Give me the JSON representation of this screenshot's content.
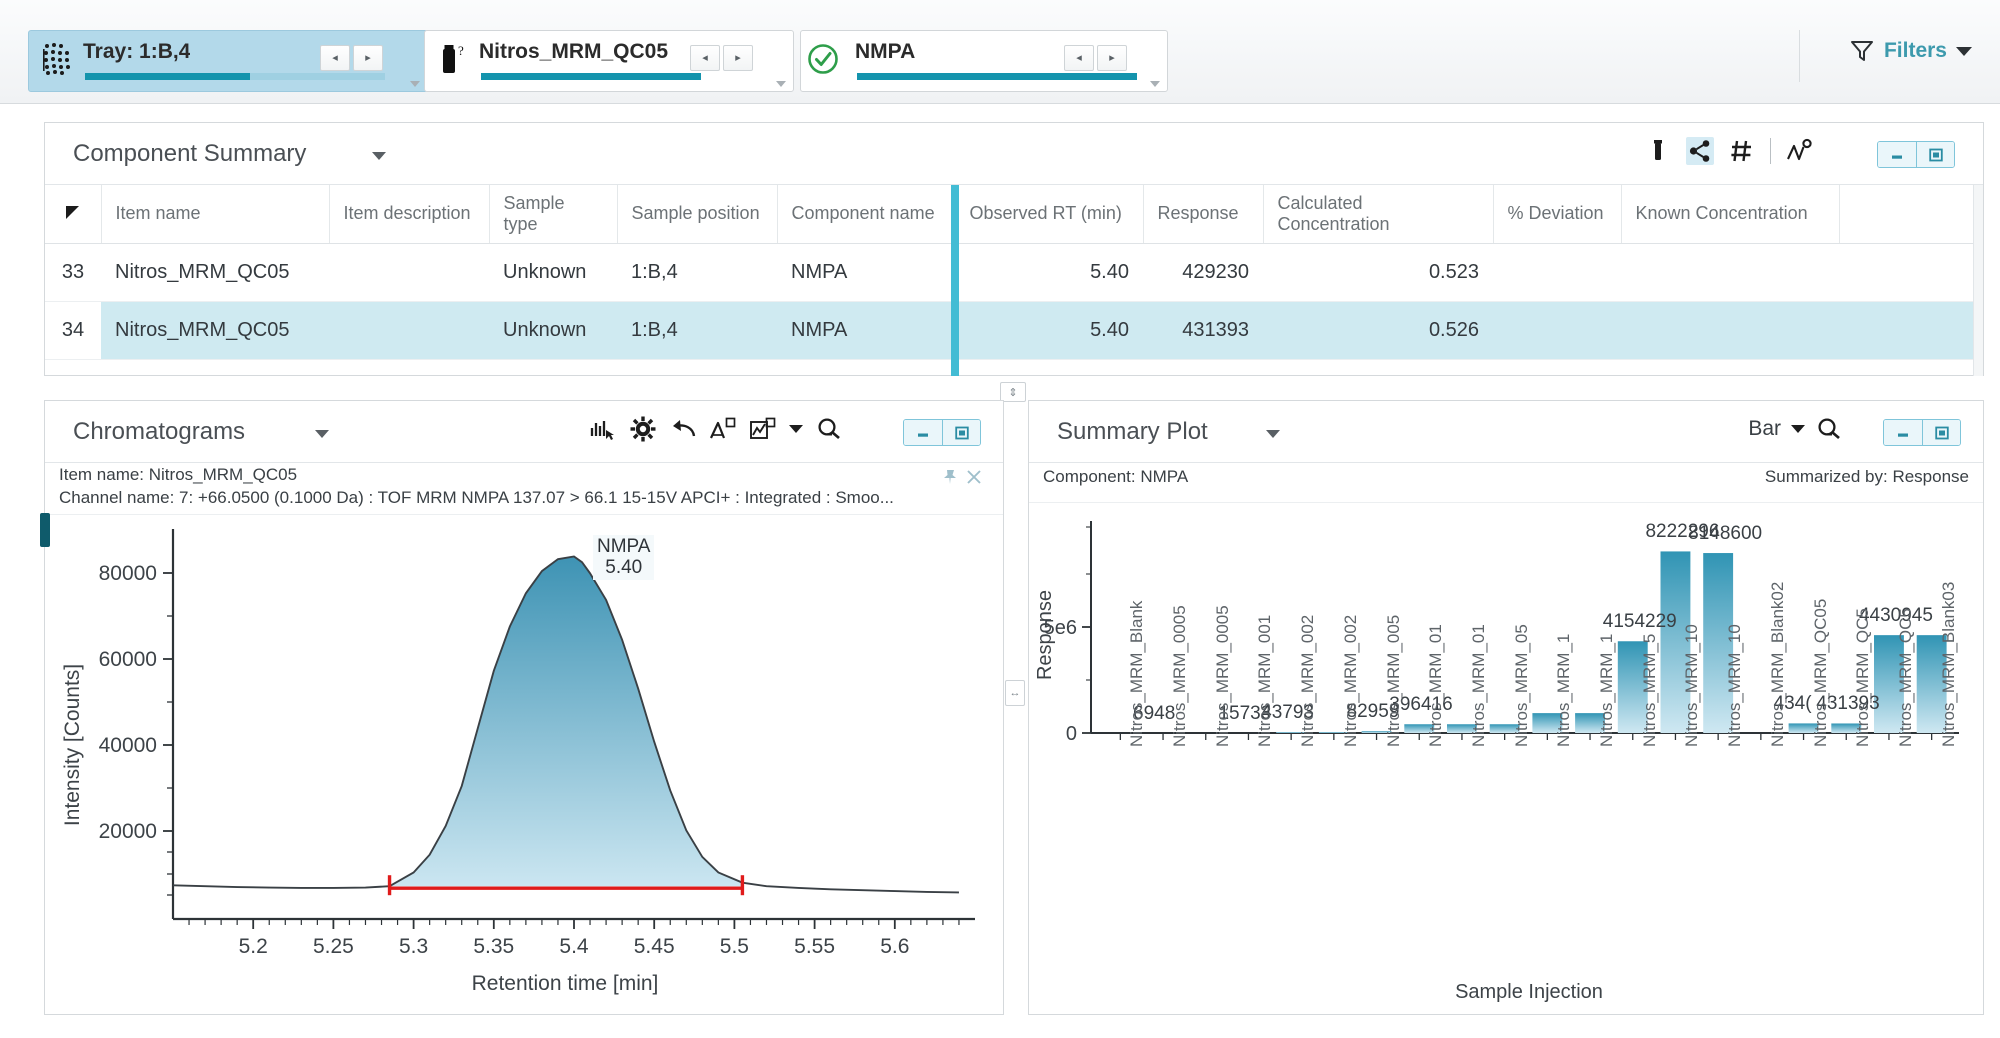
{
  "topbar": {
    "chips": [
      {
        "icon": "tray-grid-icon",
        "label": "Tray: 1:B,4",
        "progress": 55,
        "active": true
      },
      {
        "icon": "vial-question-icon",
        "label": "Nitros_MRM_QC05",
        "progress": 100,
        "active": false
      },
      {
        "icon": "check-circle-icon",
        "label": "NMPA",
        "progress": 100,
        "active": false
      }
    ],
    "prev_label": "◂",
    "next_label": "▸",
    "filters_label": "Filters"
  },
  "component_summary": {
    "title": "Component Summary",
    "tools": [
      "vial-icon",
      "share-icon",
      "hash-icon",
      "peak-settings-icon"
    ],
    "window_buttons": [
      "minimize-icon",
      "maximize-icon"
    ],
    "columns": [
      "Item name",
      "Item description",
      "Sample type",
      "Sample position",
      "Component name",
      "Observed RT (min)",
      "Response",
      "Calculated Concentration",
      "% Deviation",
      "Known Concentration",
      ""
    ],
    "rows": [
      {
        "index": "33",
        "item_name": "Nitros_MRM_QC05",
        "item_description": "",
        "sample_type": "Unknown",
        "sample_position": "1:B,4",
        "component_name": "NMPA",
        "observed_rt": "5.40",
        "response": "429230",
        "calculated_concentration": "0.523",
        "pct_deviation": "",
        "known_concentration": "",
        "selected": false
      },
      {
        "index": "34",
        "item_name": "Nitros_MRM_QC05",
        "item_description": "",
        "sample_type": "Unknown",
        "sample_position": "1:B,4",
        "component_name": "NMPA",
        "observed_rt": "5.40",
        "response": "431393",
        "calculated_concentration": "0.526",
        "pct_deviation": "",
        "known_concentration": "",
        "selected": true
      }
    ]
  },
  "chromatograms": {
    "title": "Chromatograms",
    "tools": [
      "peak-pick-icon",
      "gear-icon",
      "undo-icon",
      "integrate-icon",
      "chart-type-icon",
      "chart-type-caret",
      "zoom-icon"
    ],
    "window_buttons": [
      "minimize-icon",
      "maximize-icon"
    ],
    "item_name_line": "Item name: Nitros_MRM_QC05",
    "channel_name_line": "Channel name: 7: +66.0500 (0.1000 Da) : TOF MRM NMPA 137.07 > 66.1 15-15V APCI+ : Integrated : Smoo...",
    "pin_icon": "pin-icon",
    "close_icon": "close-icon",
    "peak_label": {
      "name": "NMPA",
      "rt": "5.40"
    }
  },
  "summary_plot": {
    "title": "Summary Plot",
    "chart_type_label": "Bar",
    "zoom_icon": "zoom-icon",
    "window_buttons": [
      "minimize-icon",
      "maximize-icon"
    ],
    "component_line": "Component: NMPA",
    "summarized_line": "Summarized by: Response"
  },
  "chart_data": [
    {
      "type": "line",
      "name": "chromatogram",
      "title": "",
      "xlabel": "Retention time [min]",
      "ylabel": "Intensity [Counts]",
      "xlim": [
        5.15,
        5.65
      ],
      "ylim": [
        0,
        88000
      ],
      "xticks": [
        "5.2",
        "5.25",
        "5.3",
        "5.35",
        "5.4",
        "5.45",
        "5.5",
        "5.55",
        "5.6"
      ],
      "xtick_values": [
        5.2,
        5.25,
        5.3,
        5.35,
        5.4,
        5.45,
        5.5,
        5.55,
        5.6
      ],
      "yticks": [
        "20000",
        "40000",
        "60000",
        "80000"
      ],
      "ytick_values": [
        20000,
        40000,
        60000,
        80000
      ],
      "grid": false,
      "fill": true,
      "integration_baseline": {
        "start_x": 5.285,
        "end_x": 5.505,
        "color": "#e01b1b"
      },
      "annotation": {
        "text": "NMPA 5.40",
        "x": 5.4,
        "y": 81000
      },
      "x": [
        5.15,
        5.17,
        5.19,
        5.21,
        5.23,
        5.25,
        5.27,
        5.285,
        5.3,
        5.31,
        5.32,
        5.33,
        5.34,
        5.35,
        5.36,
        5.37,
        5.38,
        5.39,
        5.4,
        5.405,
        5.41,
        5.42,
        5.43,
        5.44,
        5.45,
        5.46,
        5.47,
        5.48,
        5.49,
        5.505,
        5.52,
        5.54,
        5.56,
        5.58,
        5.6,
        5.62,
        5.64
      ],
      "y": [
        7600,
        7400,
        7200,
        7100,
        7000,
        7000,
        7100,
        7400,
        10500,
        14500,
        21000,
        30000,
        43000,
        56000,
        66000,
        73500,
        78500,
        81200,
        81800,
        80500,
        78000,
        72000,
        63000,
        52000,
        40000,
        29000,
        20000,
        14000,
        10500,
        8200,
        7400,
        7000,
        6700,
        6500,
        6300,
        6100,
        6000
      ]
    },
    {
      "type": "bar",
      "name": "summary-plot",
      "title": "",
      "xlabel": "Sample Injection",
      "ylabel": "Response",
      "ylim": [
        0,
        9600000
      ],
      "yticks": [
        "0",
        "5e6"
      ],
      "ytick_values": [
        0,
        5000000
      ],
      "grid": false,
      "bar_color_top": "#3094b4",
      "bar_color_bottom": "#cfe8f2",
      "categories": [
        "Nitros_MRM_Blank",
        "Nitros_MRM_0005",
        "Nitros_MRM_0005",
        "Nitros_MRM_001",
        "Nitros_MRM_002",
        "Nitros_MRM_002",
        "Nitros_MRM_005",
        "Nitros_MRM_01",
        "Nitros_MRM_01",
        "Nitros_MRM_05",
        "Nitros_MRM_1",
        "Nitros_MRM_1",
        "Nitros_MRM_5",
        "Nitros_MRM_10",
        "Nitros_MRM_10",
        "Nitros_MRM_Blank02",
        "Nitros_MRM_QC05",
        "Nitros_MRM_QC5",
        "Nitros_MRM_QC5",
        "Nitros_MRM_Blank03"
      ],
      "values": [
        0,
        6948,
        6948,
        15733,
        43793,
        43793,
        82959,
        396416,
        396416,
        396416,
        900000,
        900000,
        4154229,
        8222296,
        8148600,
        0,
        434000,
        431393,
        4430945,
        4430945
      ],
      "data_labels": [
        {
          "index": 1,
          "text": "6948"
        },
        {
          "index": 3,
          "text": "15733"
        },
        {
          "index": 4,
          "text": "43793"
        },
        {
          "index": 6,
          "text": "82959"
        },
        {
          "index": 7,
          "text": "396416"
        },
        {
          "index": 12,
          "text": "4154229"
        },
        {
          "index": 13,
          "text": "8222296"
        },
        {
          "index": 14,
          "text": "8148600"
        },
        {
          "index": 16,
          "text": "434("
        },
        {
          "index": 17,
          "text": "431393"
        },
        {
          "index": 18,
          "text": "4430945"
        }
      ]
    }
  ]
}
